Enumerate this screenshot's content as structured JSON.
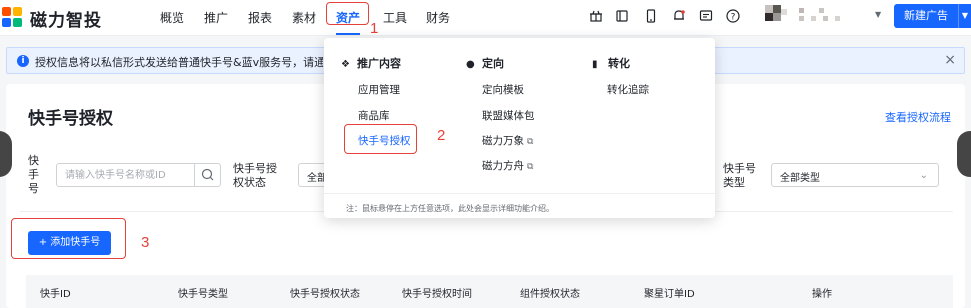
{
  "brand": {
    "name": "磁力智投"
  },
  "nav": {
    "items": [
      {
        "label": "概览"
      },
      {
        "label": "推广"
      },
      {
        "label": "报表"
      },
      {
        "label": "素材"
      },
      {
        "label": "资产"
      },
      {
        "label": "工具"
      },
      {
        "label": "财务"
      }
    ],
    "active": "资产"
  },
  "toolbar": {
    "icons": [
      "gift-icon",
      "message-icon",
      "mobile-icon",
      "bell-icon",
      "chat-icon",
      "help-icon"
    ],
    "new_ad_label": "新建广告"
  },
  "notice": {
    "text": "授权信息将以私信形式发送给普通快手号&蓝v服务号，请通知账号关注"
  },
  "page": {
    "title": "快手号授权",
    "flow_link": "查看授权流程"
  },
  "filters": {
    "account_label": "快手号",
    "search_placeholder": "请输入快手号名称或ID",
    "auth_status_label": "快手号授权状态",
    "auth_status_value": "全部",
    "account_type_label": "快手号类型",
    "account_type_value": "全部类型"
  },
  "actions": {
    "add_label": "+ 添加快手号"
  },
  "table": {
    "columns": [
      "快手ID",
      "快手号类型",
      "快手号授权状态",
      "快手号授权时间",
      "组件授权状态",
      "聚星订单ID",
      "操作"
    ]
  },
  "dropdown": {
    "columns": [
      {
        "title": "推广内容",
        "icon": "layers-icon",
        "items": [
          {
            "label": "应用管理",
            "external": false
          },
          {
            "label": "商品库",
            "external": false
          },
          {
            "label": "快手号授权",
            "external": false,
            "active": true
          }
        ]
      },
      {
        "title": "定向",
        "icon": "user-icon",
        "items": [
          {
            "label": "定向模板",
            "external": false
          },
          {
            "label": "联盟媒体包",
            "external": false
          },
          {
            "label": "磁力万象",
            "external": true
          },
          {
            "label": "磁力方舟",
            "external": true
          }
        ]
      },
      {
        "title": "转化",
        "icon": "bar-chart-icon",
        "items": [
          {
            "label": "转化追踪",
            "external": false
          }
        ]
      }
    ],
    "footer": "注：鼠标悬停在上方任意选项，此处会显示详细功能介绍。"
  },
  "annotations": [
    "1",
    "2",
    "3"
  ],
  "colors": {
    "accent": "#1766ff",
    "annotation": "#e5413a",
    "notice_bg": "#eaf1ff"
  }
}
